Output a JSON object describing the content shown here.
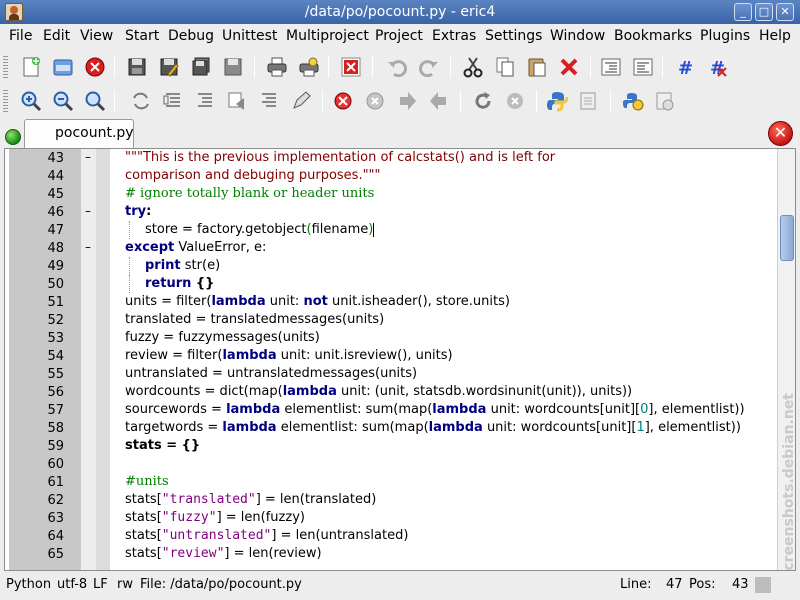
{
  "window": {
    "title": "/data/po/pocount.py - eric4"
  },
  "menu": [
    "File",
    "Edit",
    "View",
    "Start",
    "Debug",
    "Unittest",
    "Multiproject",
    "Project",
    "Extras",
    "Settings",
    "Window",
    "Bookmarks",
    "Plugins",
    "Help"
  ],
  "tab": {
    "label": "pocount.py"
  },
  "editor": {
    "lines": [
      {
        "n": "43",
        "fold": "–"
      },
      {
        "n": "44",
        "fold": ""
      },
      {
        "n": "45",
        "fold": ""
      },
      {
        "n": "46",
        "fold": "–"
      },
      {
        "n": "47",
        "fold": ""
      },
      {
        "n": "48",
        "fold": "–"
      },
      {
        "n": "49",
        "fold": ""
      },
      {
        "n": "50",
        "fold": ""
      },
      {
        "n": "51",
        "fold": ""
      },
      {
        "n": "52",
        "fold": ""
      },
      {
        "n": "53",
        "fold": ""
      },
      {
        "n": "54",
        "fold": ""
      },
      {
        "n": "55",
        "fold": ""
      },
      {
        "n": "56",
        "fold": ""
      },
      {
        "n": "57",
        "fold": ""
      },
      {
        "n": "58",
        "fold": ""
      },
      {
        "n": "59",
        "fold": ""
      },
      {
        "n": "60",
        "fold": ""
      },
      {
        "n": "61",
        "fold": ""
      },
      {
        "n": "62",
        "fold": ""
      },
      {
        "n": "63",
        "fold": ""
      },
      {
        "n": "64",
        "fold": ""
      },
      {
        "n": "65",
        "fold": ""
      }
    ],
    "code": {
      "l43": "\"\"\"This is the previous implementation of calcstats() and is left for",
      "l44": "comparison and debuging purposes.\"\"\"",
      "l45": "# ignore totally blank or header units",
      "l46_kw": "try",
      "l46_op": ":",
      "l47_a": "store = factory.getobject",
      "l47_b": "(",
      "l47_c": "filename",
      "l47_d": ")",
      "l48_kw": "except",
      "l48_rest": " ValueError, e:",
      "l49_kw": "print",
      "l49_rest": " str(e)",
      "l50_kw": "return",
      "l50_rest": " {}",
      "l51_a": "units = filter(",
      "l51_kw": "lambda",
      "l51_b": " unit: ",
      "l51_kw2": "not",
      "l51_c": " unit.isheader(), store.units)",
      "l52": "translated = translatedmessages(units)",
      "l53": "fuzzy = fuzzymessages(units)",
      "l54_a": "review = filter(",
      "l54_kw": "lambda",
      "l54_b": " unit: unit.isreview(), units)",
      "l55": "untranslated = untranslatedmessages(units)",
      "l56_a": "wordcounts = dict(map(",
      "l56_kw": "lambda",
      "l56_b": " unit: (unit, statsdb.wordsinunit(unit)), units))",
      "l57_a": "sourcewords = ",
      "l57_kw": "lambda",
      "l57_b": " elementlist: sum(map(",
      "l57_kw2": "lambda",
      "l57_c": " unit: wordcounts[unit][",
      "l57_num": "0",
      "l57_d": "], elementlist))",
      "l58_a": "targetwords = ",
      "l58_kw": "lambda",
      "l58_b": " elementlist: sum(map(",
      "l58_kw2": "lambda",
      "l58_c": " unit: wordcounts[unit][",
      "l58_num": "1",
      "l58_d": "], elementlist))",
      "l59": "stats = {}",
      "l60": "",
      "l61": "#units",
      "l62_a": "stats[",
      "l62_s": "\"translated\"",
      "l62_b": "] = len(translated)",
      "l63_a": "stats[",
      "l63_s": "\"fuzzy\"",
      "l63_b": "] = len(fuzzy)",
      "l64_a": "stats[",
      "l64_s": "\"untranslated\"",
      "l64_b": "] = len(untranslated)",
      "l65_a": "stats[",
      "l65_s": "\"review\"",
      "l65_b": "] = len(review)"
    }
  },
  "watermark": "screenshots.debian.net",
  "status": {
    "language": "Python",
    "encoding": "utf-8",
    "eol": "LF",
    "mode": "rw",
    "file_label": "File: /data/po/pocount.py",
    "line_label": "Line:",
    "line_value": "47",
    "pos_label": "Pos:",
    "pos_value": "43"
  },
  "colors": {
    "keyword": "#00007f",
    "string": "#7f0000",
    "comment": "#007f00",
    "titlebar": "#3a63a6"
  }
}
